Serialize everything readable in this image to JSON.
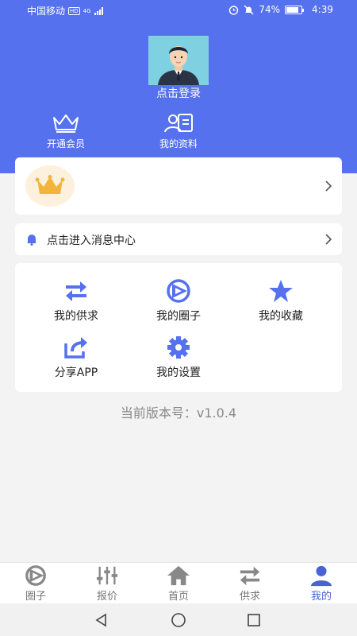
{
  "status_bar": {
    "carrier": "中国移动",
    "hd": "HD",
    "network": "4G",
    "battery": "74%",
    "time": "4:39"
  },
  "header": {
    "login_text": "点击登录",
    "vip_label": "开通会员",
    "profile_label": "我的资料"
  },
  "message_center": {
    "label": "点击进入消息中心"
  },
  "menu": {
    "items": [
      {
        "label": "我的供求",
        "icon": "swap-arrows-icon"
      },
      {
        "label": "我的圈子",
        "icon": "circle-play-icon"
      },
      {
        "label": "我的收藏",
        "icon": "star-icon"
      },
      {
        "label": "分享APP",
        "icon": "share-icon"
      },
      {
        "label": "我的设置",
        "icon": "gear-icon"
      }
    ]
  },
  "version_text": "当前版本号：v1.0.4",
  "tabbar": {
    "tabs": [
      {
        "label": "圈子",
        "icon": "circle-play-icon"
      },
      {
        "label": "报价",
        "icon": "sliders-icon"
      },
      {
        "label": "首页",
        "icon": "home-icon"
      },
      {
        "label": "供求",
        "icon": "swap-arrows-icon"
      },
      {
        "label": "我的",
        "icon": "person-icon"
      }
    ],
    "active": "我的"
  },
  "colors": {
    "primary": "#5571ee",
    "accent": "#4a63d3",
    "crown_gold": "#f3b43c"
  }
}
